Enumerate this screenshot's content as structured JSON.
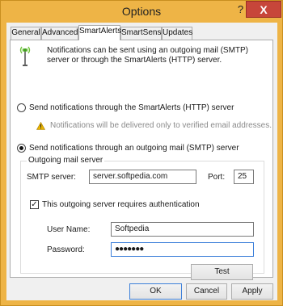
{
  "window": {
    "title": "Options",
    "help_glyph": "?",
    "close_glyph": "X"
  },
  "tabs": [
    {
      "label": "General"
    },
    {
      "label": "Advanced"
    },
    {
      "label": "SmartAlerts",
      "active": true
    },
    {
      "label": "SmartSense"
    },
    {
      "label": "Updates"
    }
  ],
  "smartalerts": {
    "info_text": "Notifications can be sent using an outgoing mail (SMTP) server or through the SmartAlerts (HTTP) server.",
    "http_option": {
      "label": "Send notifications through the SmartAlerts (HTTP) server",
      "checked": false
    },
    "http_warning": "Notifications will be delivered only to verified email addresses.",
    "smtp_option": {
      "label": "Send notifications through an outgoing mail (SMTP) server",
      "checked": true
    },
    "group_title": "Outgoing mail server",
    "smtp_server_label": "SMTP server:",
    "smtp_server_value": "server.softpedia.com",
    "port_label": "Port:",
    "port_value": "25",
    "auth_checkbox_label": "This outgoing server requires authentication",
    "auth_checked": true,
    "username_label": "User Name:",
    "username_value": "Softpedia",
    "password_label": "Password:",
    "password_value": "●●●●●●●",
    "test_button": "Test"
  },
  "footer": {
    "ok": "OK",
    "cancel": "Cancel",
    "apply": "Apply"
  },
  "colors": {
    "titlebar": "#eeb446",
    "close_button": "#c7463a",
    "focus_border": "#3c7fd9",
    "warning": "#e8b400"
  }
}
